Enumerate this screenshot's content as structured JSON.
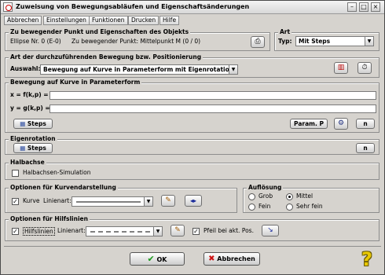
{
  "window": {
    "title": "Zuweisung von Bewegungsabläufen und Eigenschaftsänderungen"
  },
  "menu": [
    "Abbrechen",
    "Einstellungen",
    "Funktionen",
    "Drucken",
    "Hilfe"
  ],
  "object_group": {
    "title": "Zu bewegender Punkt und Eigenschaften des Objekts",
    "ellipse": "Ellipse Nr. 0 (E-0)",
    "point": "Zu bewegender Punkt: Mittelpunkt M (0 / 0)"
  },
  "art_group": {
    "title": "Art",
    "typ_label": "Typ:",
    "typ_value": "Mit Steps"
  },
  "movement_group": {
    "title": "Art der durchzuführenden Bewegung bzw. Positionierung",
    "auswahl_label": "Auswahl:",
    "auswahl_value": "Bewegung auf Kurve in Parameterform mit Eigenrotation"
  },
  "param_group": {
    "title": "Bewegung auf Kurve in Parameterform",
    "x_label": "x = f(k,p) =",
    "x_value": "",
    "y_label": "y = g(k,p) =",
    "y_value": "",
    "steps_label": "Steps",
    "param_label": "Param. P",
    "n_label": "n"
  },
  "eigenrotation_group": {
    "title": "Eigenrotation",
    "steps_label": "Steps",
    "n_label": "n"
  },
  "halbachse_group": {
    "title": "Halbachse",
    "checkbox_label": "Halbachsen-Simulation",
    "checked": false
  },
  "kurve_group": {
    "title": "Optionen für Kurvendarstellung",
    "kurve_label": "Kurve",
    "kurve_checked": true,
    "linienart_label": "Linienart:"
  },
  "aufloesung_group": {
    "title": "Auflösung",
    "options": [
      "Grob",
      "Mittel",
      "Fein",
      "Sehr fein"
    ],
    "selected": "Mittel"
  },
  "hilfslinien_group": {
    "title": "Optionen für Hilfslinien",
    "hilfslinien_label": "Hilfslinien",
    "hilfslinien_checked": true,
    "linienart_label": "Linienart:",
    "pfeil_label": "Pfeil bei akt. Pos.",
    "pfeil_checked": true
  },
  "footer": {
    "ok_label": "OK",
    "cancel_label": "Abbrechen",
    "ok_color": "#1a9a1a",
    "cancel_color": "#cc1111"
  }
}
